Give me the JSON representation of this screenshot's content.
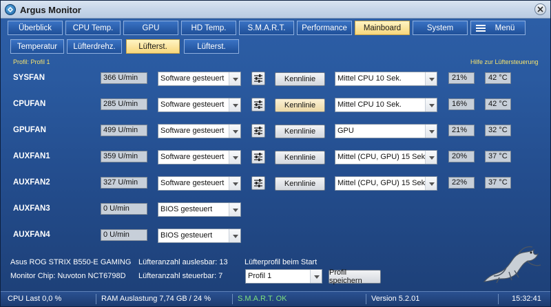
{
  "window": {
    "title": "Argus Monitor"
  },
  "tabs": [
    {
      "label": "Überblick",
      "active": false
    },
    {
      "label": "CPU Temp.",
      "active": false
    },
    {
      "label": "GPU",
      "active": false
    },
    {
      "label": "HD Temp.",
      "active": false
    },
    {
      "label": "S.M.A.R.T.",
      "active": false
    },
    {
      "label": "Performance",
      "active": false
    },
    {
      "label": "Mainboard",
      "active": true
    },
    {
      "label": "System",
      "active": false
    },
    {
      "label": "Menü",
      "active": false
    }
  ],
  "subtabs": [
    {
      "label": "Temperatur",
      "active": false
    },
    {
      "label": "Lüfterdrehz.",
      "active": false
    },
    {
      "label": "Lüfterst.",
      "active": true
    },
    {
      "label": "Lüfterst.",
      "active": false
    }
  ],
  "profile_label": "Profil: Profil 1",
  "help_link": "Hilfe zur Lüftersteuerung",
  "fans": [
    {
      "name": "SYSFAN",
      "rpm": "366 U/min",
      "mode": "Software gesteuert",
      "curve": "Kennlinie",
      "source": "Mittel CPU 10 Sek.",
      "percent": "21%",
      "temp": "42 °C"
    },
    {
      "name": "CPUFAN",
      "rpm": "285 U/min",
      "mode": "Software gesteuert",
      "curve": "Kennlinie",
      "source": "Mittel CPU 10 Sek.",
      "percent": "16%",
      "temp": "42 °C"
    },
    {
      "name": "GPUFAN",
      "rpm": "499 U/min",
      "mode": "Software gesteuert",
      "curve": "Kennlinie",
      "source": "GPU",
      "percent": "21%",
      "temp": "32 °C"
    },
    {
      "name": "AUXFAN1",
      "rpm": "359 U/min",
      "mode": "Software gesteuert",
      "curve": "Kennlinie",
      "source": "Mittel (CPU, GPU) 15 Sek.",
      "percent": "20%",
      "temp": "37 °C"
    },
    {
      "name": "AUXFAN2",
      "rpm": "327 U/min",
      "mode": "Software gesteuert",
      "curve": "Kennlinie",
      "source": "Mittel (CPU, GPU) 15 Sek.",
      "percent": "22%",
      "temp": "37 °C"
    },
    {
      "name": "AUXFAN3",
      "rpm": "0 U/min",
      "mode": "BIOS gesteuert"
    },
    {
      "name": "AUXFAN4",
      "rpm": "0 U/min",
      "mode": "BIOS gesteuert"
    }
  ],
  "board": "Asus ROG STRIX B550-E GAMING",
  "chip": "Monitor Chip: Nuvoton NCT6798D",
  "readable": "Lüfteranzahl auslesbar: 13",
  "controllable": "Lüfteranzahl steuerbar: 7",
  "profile_start_label": "Lüfterprofil beim Start",
  "profile_select": "Profil 1",
  "save_button": "Profil speichern",
  "status": {
    "cpu": "CPU Last 0,0 %",
    "ram": "RAM Auslastung 7,74 GB / 24 %",
    "smart": "S.M.A.R.T. OK",
    "version": "Version 5.2.01",
    "time": "15:32:41"
  },
  "colors": {
    "accent": "#f7d77c",
    "smart_ok": "#7ee07e",
    "help": "#f5e36e"
  }
}
